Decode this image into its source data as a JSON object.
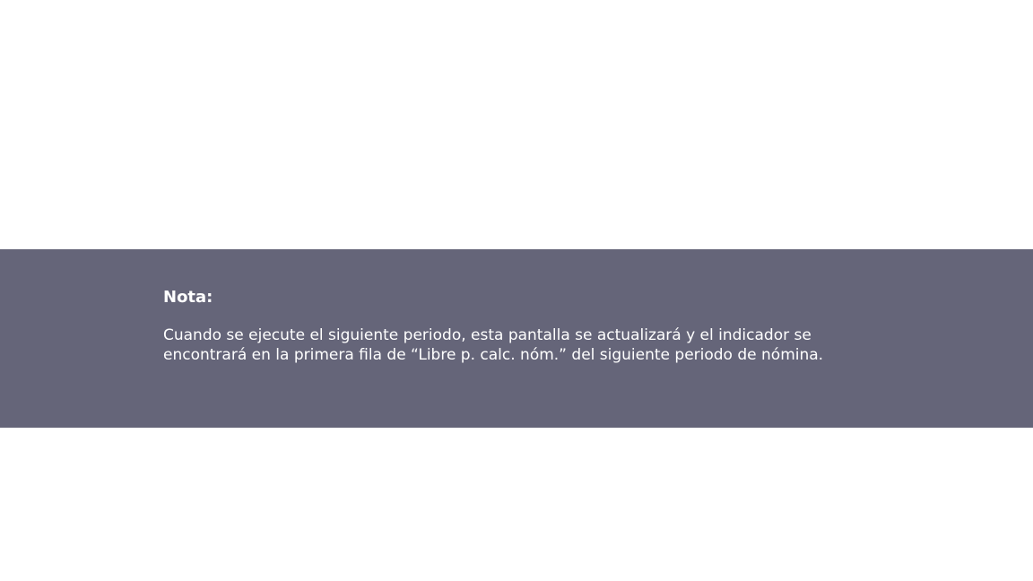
{
  "note": {
    "title": "Nota:",
    "body_lines": [
      "Cuando se ejecute el siguiente periodo, esta pantalla se actualizará y el indicador se",
      "encontrará en la primera fila de “Libre p. calc. nóm.” del siguiente periodo de nómina."
    ]
  },
  "colors": {
    "band_background": "#656579",
    "text": "#ffffff",
    "page_background": "#ffffff"
  }
}
